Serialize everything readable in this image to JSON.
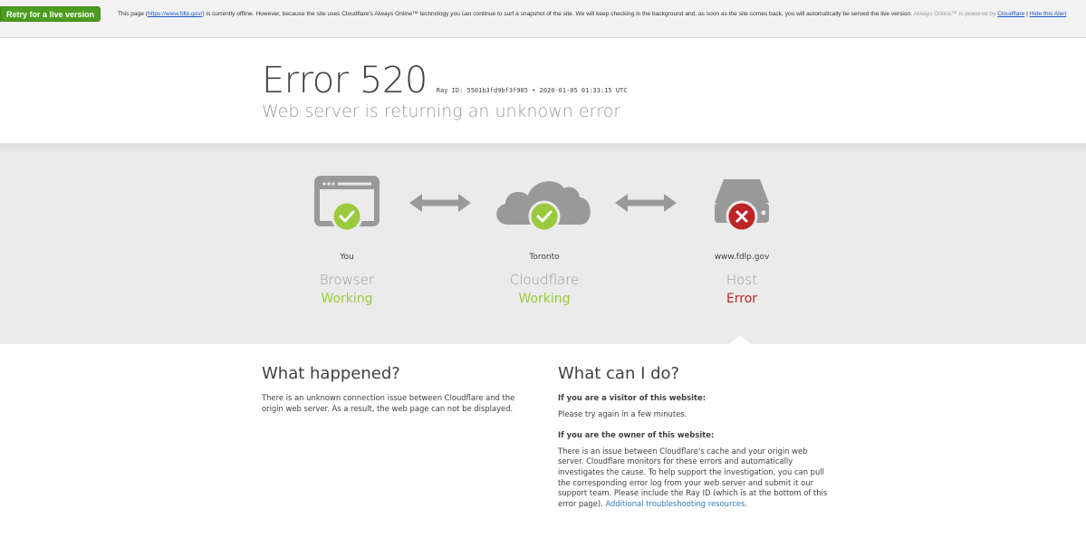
{
  "alert": {
    "retry_label": "Retry for a live version",
    "text_before": "This page (",
    "url": "https://www.fdlp.gov/",
    "text_after": ") is currently offline. However, because the site uses Cloudflare's Always Online™ technology you can continue to surf a snapshot of the site. We will keep checking in the background and, as soon as the site comes back, you will automatically be served the live version. ",
    "powered_muted": "Always Online™ is powered by ",
    "cloudflare_link": "Cloudflare",
    "separator": " | ",
    "hide_link": "Hide this Alert"
  },
  "header": {
    "error_code": "Error 520",
    "ray_info": "Ray ID: 5501b3fd9bf3f985 • 2020-01-05 01:33:15 UTC",
    "subtitle": "Web server is returning an unknown error"
  },
  "nodes": [
    {
      "location": "You",
      "kind": "Browser",
      "status": "Working",
      "ok": true
    },
    {
      "location": "Toronto",
      "kind": "Cloudflare",
      "status": "Working",
      "ok": true
    },
    {
      "location": "www.fdlp.gov",
      "kind": "Host",
      "status": "Error",
      "ok": false
    }
  ],
  "colors": {
    "ok": "#9bca3e",
    "error": "#bd2426",
    "icon_gray": "#999999",
    "link": "#2f7bbf"
  },
  "what_happened": {
    "heading": "What happened?",
    "body": "There is an unknown connection issue between Cloudflare and the origin web server. As a result, the web page can not be displayed."
  },
  "what_can_i_do": {
    "heading": "What can I do?",
    "visitor_heading": "If you are a visitor of this website:",
    "visitor_body": "Please try again in a few minutes.",
    "owner_heading": "If you are the owner of this website:",
    "owner_body": "There is an issue between Cloudflare's cache and your origin web server. Cloudflare monitors for these errors and automatically investigates the cause. To help support the investigation, you can pull the corresponding error log from your web server and submit it our support team. Please include the Ray ID (which is at the bottom of this error page). ",
    "owner_link": "Additional troubleshooting resources",
    "owner_end": "."
  }
}
